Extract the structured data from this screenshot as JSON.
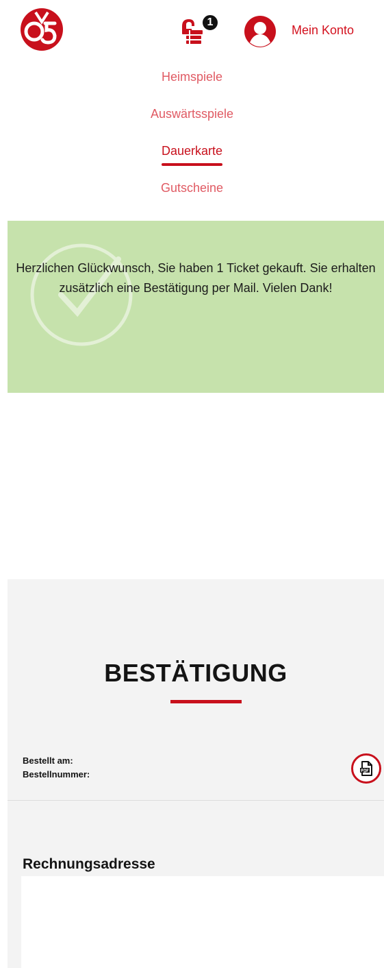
{
  "header": {
    "logo_icon": "mainz-05-logo-icon",
    "cart_icon": "ticket-cart-icon",
    "cart_count": "1",
    "avatar_icon": "user-avatar-icon",
    "account_label": "Mein Konto"
  },
  "nav": {
    "items": [
      {
        "label": "Heimspiele",
        "active": false
      },
      {
        "label": "Auswärtsspiele",
        "active": false
      },
      {
        "label": "Dauerkarte",
        "active": true
      },
      {
        "label": "Gutscheine",
        "active": false
      }
    ]
  },
  "success": {
    "icon": "check-circle-icon",
    "message": "Herzlichen Glückwunsch, Sie haben 1 Ticket gekauft. Sie erhalten zusätzlich eine Bestätigung per Mail. Vielen Dank!"
  },
  "confirmation": {
    "title": "BESTÄTIGUNG",
    "ordered_on_label": "Bestellt am:",
    "order_number_label": "Bestellnummer:",
    "pdf_icon": "pdf-download-icon",
    "billing_heading": "Rechnungsadresse"
  },
  "colors": {
    "brand_red": "#c8101c",
    "nav_red": "#e05a63",
    "success_green": "#c6e2ac",
    "section_gray": "#f3f3f3"
  }
}
